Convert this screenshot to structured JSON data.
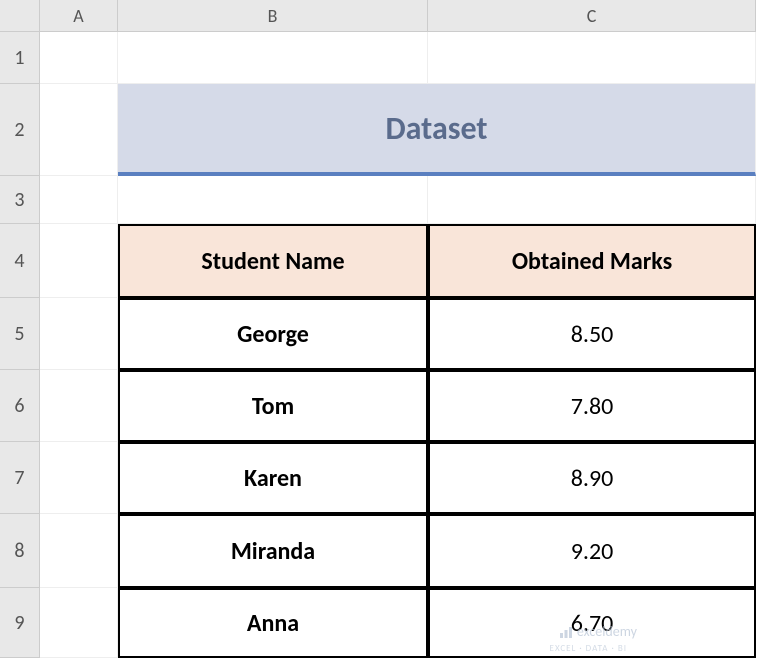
{
  "columns": [
    "A",
    "B",
    "C"
  ],
  "rows": [
    "1",
    "2",
    "3",
    "4",
    "5",
    "6",
    "7",
    "8",
    "9"
  ],
  "title": "Dataset",
  "table": {
    "headers": [
      "Student Name",
      "Obtained Marks"
    ],
    "data": [
      {
        "name": "George",
        "marks": "8.50"
      },
      {
        "name": "Tom",
        "marks": "7.80"
      },
      {
        "name": "Karen",
        "marks": "8.90"
      },
      {
        "name": "Miranda",
        "marks": "9.20"
      },
      {
        "name": "Anna",
        "marks": "6.70"
      }
    ]
  },
  "watermark": {
    "brand": "exceldemy",
    "tagline": "EXCEL · DATA · BI"
  }
}
